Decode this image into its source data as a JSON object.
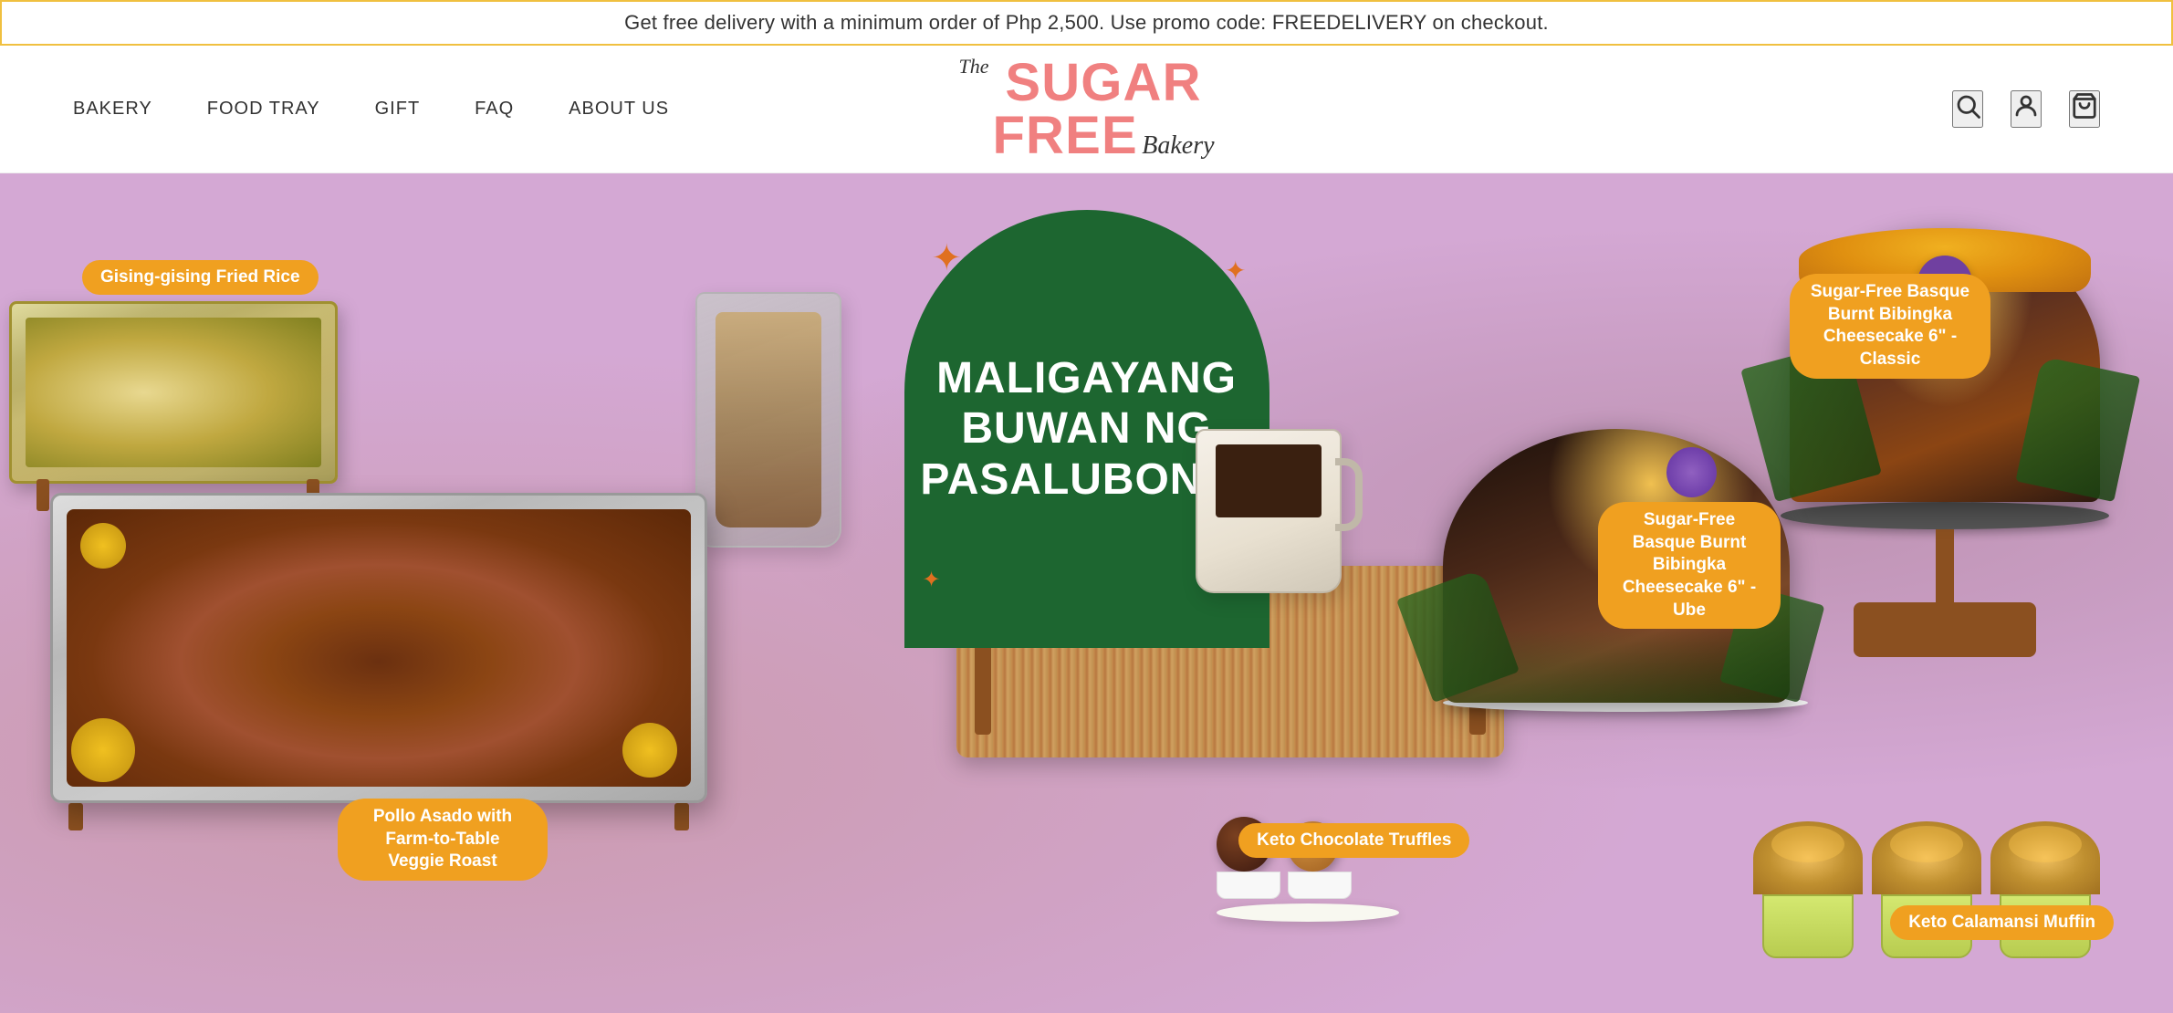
{
  "announcement": {
    "text": "Get free delivery with a minimum order of Php 2,500. Use promo code: FREEDELIVERY on checkout."
  },
  "header": {
    "nav": [
      {
        "label": "BAKERY",
        "id": "bakery"
      },
      {
        "label": "FOOD TRAY",
        "id": "food-tray"
      },
      {
        "label": "GIFT",
        "id": "gift"
      },
      {
        "label": "FAQ",
        "id": "faq"
      },
      {
        "label": "ABOUT US",
        "id": "about-us"
      }
    ],
    "logo": {
      "the": "The",
      "sugar": "SUGAR",
      "free": "FREE",
      "bakery": "Bakery"
    },
    "icons": {
      "search": "🔍",
      "account": "👤",
      "cart": "🛒"
    }
  },
  "hero": {
    "arch_text": "MALIGAYANG BUWAN NG PASALUBONG!",
    "labels": {
      "fried_rice": "Gising-gising Fried Rice",
      "pollo": "Pollo Asado with Farm-to-Table Veggie Roast",
      "truffles": "Keto Chocolate Truffles",
      "ube_cake": "Sugar-Free Basque Burnt Bibingka Cheesecake 6\" - Ube",
      "classic_cake": "Sugar-Free Basque Burnt Bibingka Cheesecake 6\" - Classic",
      "muffin": "Keto Calamansi Muffin"
    }
  }
}
